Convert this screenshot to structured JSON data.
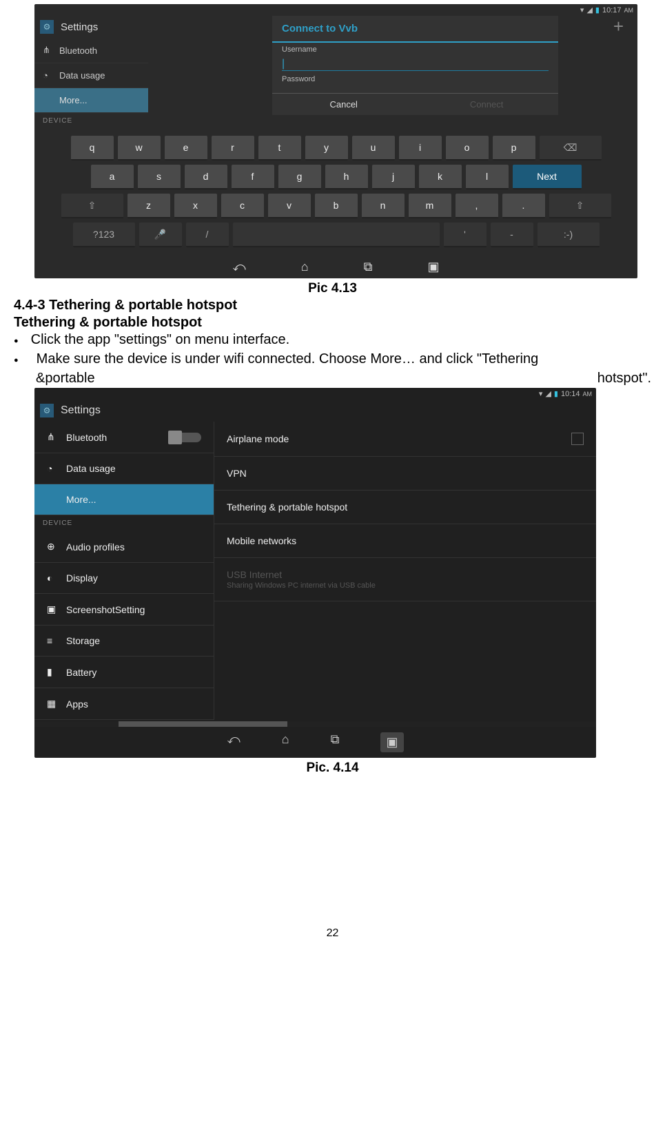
{
  "shot1": {
    "status": {
      "time": "10:17",
      "ampm": "AM"
    },
    "settings_label": "Settings",
    "side": {
      "bluetooth": "Bluetooth",
      "datausage": "Data usage",
      "more": "More...",
      "device_header": "DEVICE"
    },
    "dialog": {
      "title": "Connect to Vvb",
      "username_label": "Username",
      "password_label": "Password",
      "cancel": "Cancel",
      "connect": "Connect"
    },
    "keyboard": {
      "row1": [
        "q",
        "w",
        "e",
        "r",
        "t",
        "y",
        "u",
        "i",
        "o",
        "p"
      ],
      "row2": [
        "a",
        "s",
        "d",
        "f",
        "g",
        "h",
        "j",
        "k",
        "l"
      ],
      "row3": [
        "z",
        "x",
        "c",
        "v",
        "b",
        "n",
        "m",
        ",",
        "."
      ],
      "sym": "?123",
      "slash": "/",
      "apos": "'",
      "dash": "-",
      "smile": ":-)",
      "next": "Next",
      "backspace": "⌫",
      "shift": "⇧",
      "mic": "🎤"
    },
    "caption": "Pic 4.13"
  },
  "text": {
    "h443": "4.4-3 Tethering & portable hotspot",
    "h_teth": "Tethering & portable hotspot",
    "bullet1": "Click the app \"settings\" on menu interface.",
    "bullet2a": "Make sure the device is under wifi connected. Choose More… and click \"Tethering",
    "bullet2_left": "&portable",
    "bullet2_right": "hotspot\"."
  },
  "shot2": {
    "status": {
      "time": "10:14",
      "ampm": "AM"
    },
    "settings_label": "Settings",
    "left": {
      "bluetooth": "Bluetooth",
      "datausage": "Data usage",
      "more": "More...",
      "device_header": "DEVICE",
      "audio": "Audio profiles",
      "display": "Display",
      "screenshot": "ScreenshotSetting",
      "storage": "Storage",
      "battery": "Battery",
      "apps": "Apps"
    },
    "right": {
      "airplane": "Airplane mode",
      "vpn": "VPN",
      "tether": "Tethering & portable hotspot",
      "mobile": "Mobile networks",
      "usb": "USB Internet",
      "usb_sub": "Sharing Windows PC internet via USB cable"
    },
    "caption": "Pic. 4.14"
  },
  "page_number": "22"
}
